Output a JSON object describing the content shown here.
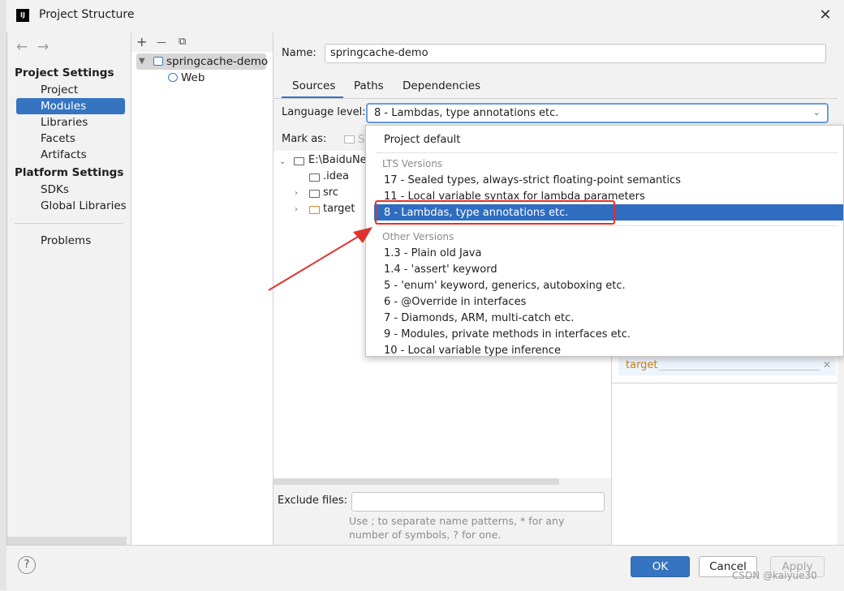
{
  "window": {
    "title": "Project Structure",
    "close_symbol": "✕",
    "app_icon_text": "IJ"
  },
  "nav": {
    "back": "←",
    "forward": "→"
  },
  "sidebar": {
    "project_settings_heading": "Project Settings",
    "project_items": [
      "Project",
      "Modules",
      "Libraries",
      "Facets",
      "Artifacts"
    ],
    "selected": "Modules",
    "platform_settings_heading": "Platform Settings",
    "platform_items": [
      "SDKs",
      "Global Libraries"
    ],
    "problems": "Problems"
  },
  "module_tree": {
    "toolbar": {
      "add": "+",
      "remove": "—",
      "copy": "⧉"
    },
    "root": "springcache-demo",
    "child": "Web"
  },
  "module_detail": {
    "name_label": "Name:",
    "name_value": "springcache-demo",
    "tabs": [
      "Sources",
      "Paths",
      "Dependencies"
    ],
    "active_tab": "Sources",
    "language_level_label": "Language level:",
    "language_level_value": "8 - Lambdas, type annotations etc.",
    "mark_as_label": "Mark as:",
    "mark_as_partial": "S",
    "content_tree": {
      "root": "E:\\BaiduNe",
      "children": [
        ".idea",
        "src",
        "target"
      ]
    },
    "excluded_item": "target",
    "exclude_files_label": "Exclude files:",
    "exclude_hint": "Use ; to separate name patterns, * for any number of symbols, ? for one."
  },
  "language_dropdown": {
    "project_default": "Project default",
    "lts_heading": "LTS Versions",
    "lts_items": [
      "17 - Sealed types, always-strict floating-point semantics",
      "11 - Local variable syntax for lambda parameters",
      "8 - Lambdas, type annotations etc."
    ],
    "selected": "8 - Lambdas, type annotations etc.",
    "other_heading": "Other Versions",
    "other_items": [
      "1.3 - Plain old Java",
      "1.4 - 'assert' keyword",
      "5 - 'enum' keyword, generics, autoboxing etc.",
      "6 - @Override in interfaces",
      "7 - Diamonds, ARM, multi-catch etc.",
      "9 - Modules, private methods in interfaces etc.",
      "10 - Local variable type inference"
    ]
  },
  "footer": {
    "help": "?",
    "ok": "OK",
    "cancel": "Cancel",
    "apply": "Apply"
  },
  "watermark": "CSDN @kaiyue30",
  "colors": {
    "accent": "#3574c0",
    "annotation_red": "#e0322d"
  }
}
